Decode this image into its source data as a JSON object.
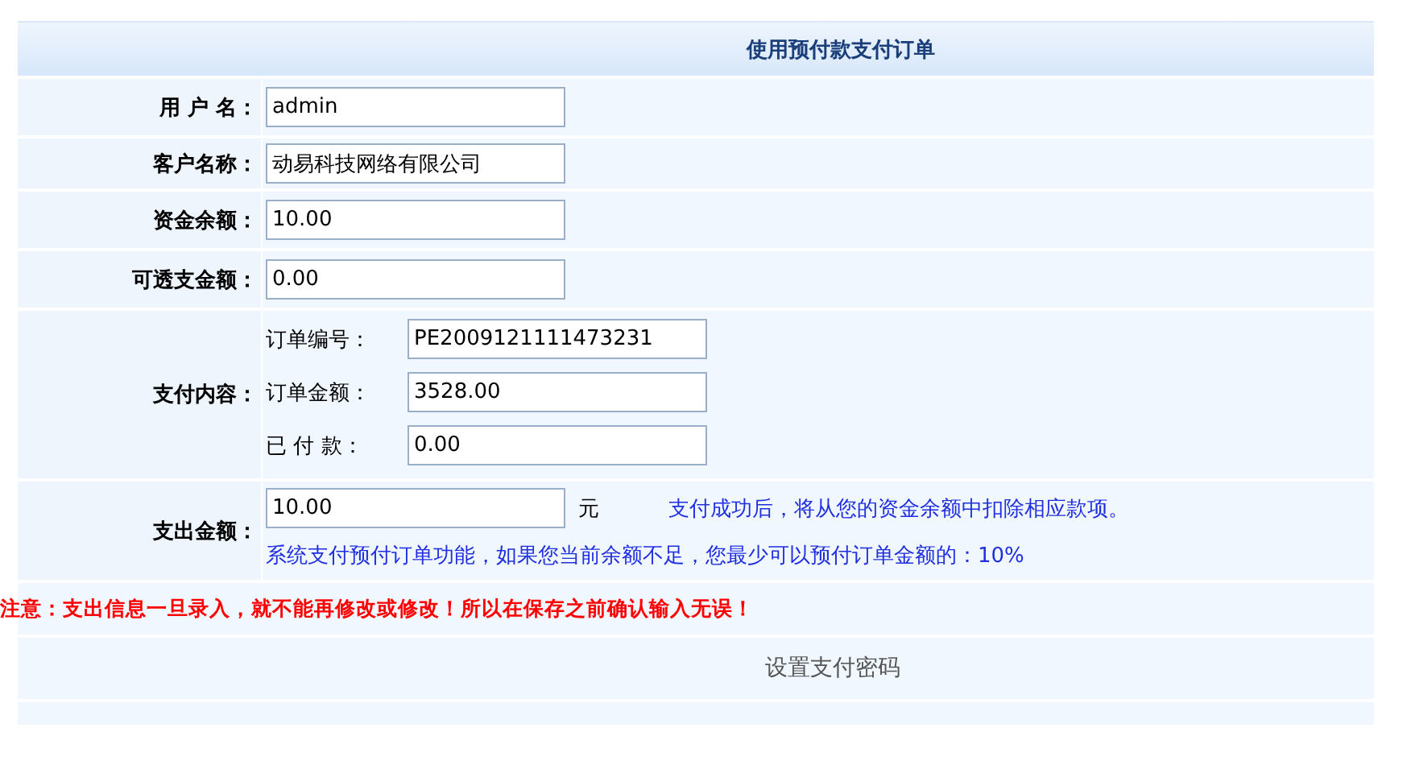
{
  "title": "使用预付款支付订单",
  "fields": [
    {
      "label": "用 户 名：",
      "value": "admin"
    },
    {
      "label": "客户名称：",
      "value": "动易科技网络有限公司"
    },
    {
      "label": "资金余额：",
      "value": "10.00"
    },
    {
      "label": "可透支金额：",
      "value": "0.00"
    }
  ],
  "payment_content": {
    "label": "支付内容：",
    "items": [
      {
        "label": "订单编号：",
        "value": "PE2009121111473231"
      },
      {
        "label": "订单金额：",
        "value": "3528.00"
      },
      {
        "label": "已 付 款：",
        "value": "0.00"
      }
    ]
  },
  "expense": {
    "label": "支出金额：",
    "value": "10.00",
    "unit": "元",
    "note": "支付成功后，将从您的资金余额中扣除相应款项。",
    "hint": "系统支付预付订单功能，如果您当前余额不足，您最少可以预付订单金额的：10%"
  },
  "warning": "注意：支出信息一旦录入，就不能再修改或修改！所以在保存之前确认输入无误！",
  "set_password_link": "设置支付密码"
}
